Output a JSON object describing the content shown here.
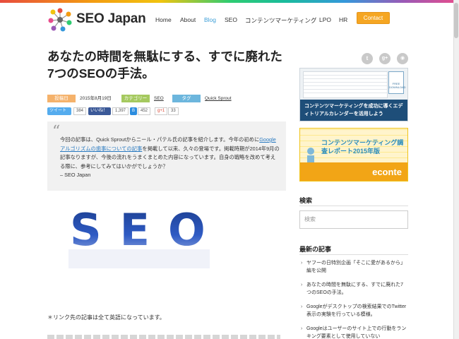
{
  "brand": {
    "name": "SEO Japan",
    "accent": "#3fa0d8",
    "contact_color": "#f5a623"
  },
  "nav": {
    "items": [
      "Home",
      "About",
      "Blog",
      "SEO",
      "コンテンツマーケティング",
      "LPO",
      "HR"
    ],
    "active": "Blog",
    "contact": "Contact"
  },
  "article": {
    "title": "あなたの時間を無駄にする、すでに廃れた7つのSEOの手法。",
    "meta": {
      "date_label": "投稿日",
      "date": "2015年8月19日",
      "category_label": "カテゴリー",
      "category": "SEO",
      "tag_label": "タグ",
      "tag": "Quick Sprout"
    },
    "share": {
      "tweet": "ツイート",
      "tweet_count": "384",
      "like": "いいね！",
      "like_count": "1,397",
      "hatena_count": "452",
      "gplus": "g+1",
      "gplus_count": "33"
    },
    "quote": {
      "part1": "今回の記事は、Quick Sproutからニール・パテル氏の記事を紹介します。今年の初めに",
      "link": "Googleアルゴリズムの歯事についての記事",
      "part2": "を掲載して以来、久々の登場です。掲載時期が2014年9月の記事なりますが、今後の流れをうまくまとめた内容になっています。自身の戦略を改めて考える際に、参考にしてみてはいかがでしょうか？",
      "signature": "– SEO Japan"
    },
    "image_text": "SEO",
    "footnote": "＊リンク先の記事は全て英語になっています。"
  },
  "sidebar": {
    "social": [
      "twitter-icon",
      "google-plus-icon",
      "rss-icon"
    ],
    "banner1": {
      "text": "コンテンツマーケティングを成功に導くエディトリアルカレンダーを活用しよう",
      "download": "FREE DOWNLOAD"
    },
    "banner2": {
      "title": "コンテンツマーケティング調査レポート2015年版",
      "logo": "econte"
    },
    "search": {
      "heading": "検索",
      "placeholder": "検索"
    },
    "recent": {
      "heading": "最新の記事",
      "items": [
        "ヤフーの日特別企画「そこに愛があるから」編を公開",
        "あなたの時間を無駄にする、すでに廃れた7つのSEOの手法。",
        "Googleがデスクトップの検索結果でのTwitter表示の実験を行っている模様。",
        "Googleはユーザーのサイト上での行動をランキング要素として使用していない"
      ]
    }
  }
}
